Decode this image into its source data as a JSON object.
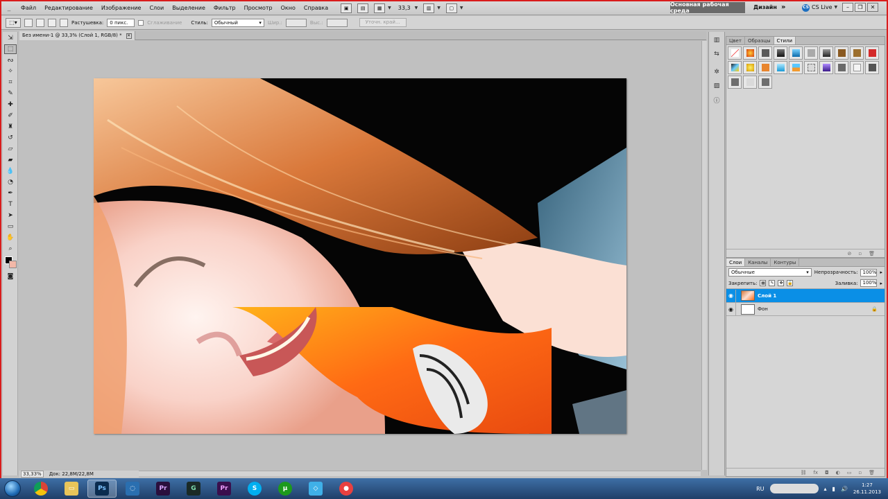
{
  "menubar": {
    "items": [
      "Файл",
      "Редактирование",
      "Изображение",
      "Слои",
      "Выделение",
      "Фильтр",
      "Просмотр",
      "Окно",
      "Справка"
    ],
    "zoom": "33,3",
    "workspace": "Основная рабочая среда",
    "design": "Дизайн",
    "more": "»",
    "cs_live": "CS Live"
  },
  "options": {
    "feather_label": "Растушевка:",
    "feather_value": "0 пикс.",
    "antialias_label": "Сглаживание",
    "style_label": "Стиль:",
    "style_value": "Обычный",
    "width_label": "Шир.:",
    "height_label": "Выс.:",
    "refine_button": "Уточн. край..."
  },
  "document": {
    "tab_title": "Без имени-1 @ 33,3% (Слой 1, RGB/8) *"
  },
  "status": {
    "zoom": "33,33%",
    "doc_size": "Док: 22,8M/22,8M"
  },
  "styles_panel": {
    "tabs": [
      "Цвет",
      "Образцы",
      "Стили"
    ],
    "active_tab": "Стили"
  },
  "layers_panel": {
    "tabs": [
      "Слои",
      "Каналы",
      "Контуры"
    ],
    "blend_mode": "Обычные",
    "opacity_label": "Непрозрачность:",
    "opacity": "100%",
    "lock_label": "Закрепить:",
    "fill_label": "Заливка:",
    "fill": "100%",
    "layers": [
      {
        "name": "Слой 1",
        "selected": true
      },
      {
        "name": "Фон",
        "selected": false
      }
    ]
  },
  "taskbar": {
    "language": "RU",
    "time": "1:27",
    "date": "26.11.2013"
  },
  "colors": {
    "selection": "#0a8fe6",
    "frame": "#d91c1c"
  }
}
